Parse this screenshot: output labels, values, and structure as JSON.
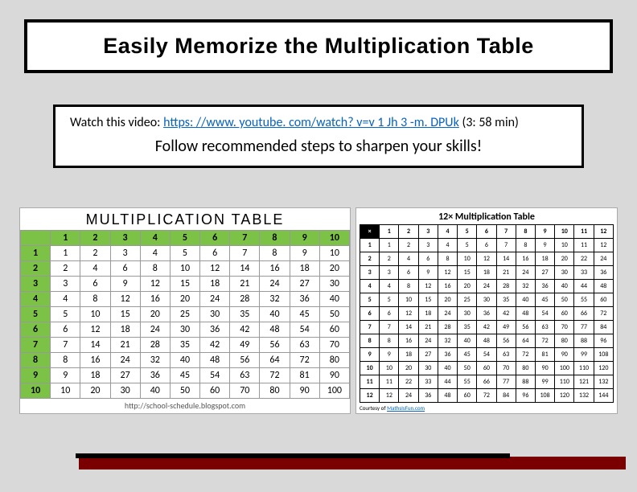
{
  "title": "Easily Memorize the Multiplication Table",
  "watch": {
    "prefix": "Watch this video: ",
    "link_text": "https: //www. youtube. com/watch? v=v 1 Jh 3 -m. DPUk",
    "duration": " (3: 58 min)"
  },
  "follow": "Follow recommended steps to sharpen your skills!",
  "table10": {
    "title": "MULTIPLICATION TABLE",
    "headers": [
      "1",
      "2",
      "3",
      "4",
      "5",
      "6",
      "7",
      "8",
      "9",
      "10"
    ],
    "rows": [
      {
        "h": "1",
        "c": [
          "1",
          "2",
          "3",
          "4",
          "5",
          "6",
          "7",
          "8",
          "9",
          "10"
        ]
      },
      {
        "h": "2",
        "c": [
          "2",
          "4",
          "6",
          "8",
          "10",
          "12",
          "14",
          "16",
          "18",
          "20"
        ]
      },
      {
        "h": "3",
        "c": [
          "3",
          "6",
          "9",
          "12",
          "15",
          "18",
          "21",
          "24",
          "27",
          "30"
        ]
      },
      {
        "h": "4",
        "c": [
          "4",
          "8",
          "12",
          "16",
          "20",
          "24",
          "28",
          "32",
          "36",
          "40"
        ]
      },
      {
        "h": "5",
        "c": [
          "5",
          "10",
          "15",
          "20",
          "25",
          "30",
          "35",
          "40",
          "45",
          "50"
        ]
      },
      {
        "h": "6",
        "c": [
          "6",
          "12",
          "18",
          "24",
          "30",
          "36",
          "42",
          "48",
          "54",
          "60"
        ]
      },
      {
        "h": "7",
        "c": [
          "7",
          "14",
          "21",
          "28",
          "35",
          "42",
          "49",
          "56",
          "63",
          "70"
        ]
      },
      {
        "h": "8",
        "c": [
          "8",
          "16",
          "24",
          "32",
          "40",
          "48",
          "56",
          "64",
          "72",
          "80"
        ]
      },
      {
        "h": "9",
        "c": [
          "9",
          "18",
          "27",
          "36",
          "45",
          "54",
          "63",
          "72",
          "81",
          "90"
        ]
      },
      {
        "h": "10",
        "c": [
          "10",
          "20",
          "30",
          "40",
          "50",
          "60",
          "70",
          "80",
          "90",
          "100"
        ]
      }
    ],
    "caption": "http://school-schedule.blogspot.com"
  },
  "table12": {
    "title": "12× Multiplication Table",
    "corner": "×",
    "headers": [
      "1",
      "2",
      "3",
      "4",
      "5",
      "6",
      "7",
      "8",
      "9",
      "10",
      "11",
      "12"
    ],
    "rows": [
      {
        "h": "1",
        "c": [
          "1",
          "2",
          "3",
          "4",
          "5",
          "6",
          "7",
          "8",
          "9",
          "10",
          "11",
          "12"
        ]
      },
      {
        "h": "2",
        "c": [
          "2",
          "4",
          "6",
          "8",
          "10",
          "12",
          "14",
          "16",
          "18",
          "20",
          "22",
          "24"
        ]
      },
      {
        "h": "3",
        "c": [
          "3",
          "6",
          "9",
          "12",
          "15",
          "18",
          "21",
          "24",
          "27",
          "30",
          "33",
          "36"
        ]
      },
      {
        "h": "4",
        "c": [
          "4",
          "8",
          "12",
          "16",
          "20",
          "24",
          "28",
          "32",
          "36",
          "40",
          "44",
          "48"
        ]
      },
      {
        "h": "5",
        "c": [
          "5",
          "10",
          "15",
          "20",
          "25",
          "30",
          "35",
          "40",
          "45",
          "50",
          "55",
          "60"
        ]
      },
      {
        "h": "6",
        "c": [
          "6",
          "12",
          "18",
          "24",
          "30",
          "36",
          "42",
          "48",
          "54",
          "60",
          "66",
          "72"
        ]
      },
      {
        "h": "7",
        "c": [
          "7",
          "14",
          "21",
          "28",
          "35",
          "42",
          "49",
          "56",
          "63",
          "70",
          "77",
          "84"
        ]
      },
      {
        "h": "8",
        "c": [
          "8",
          "16",
          "24",
          "32",
          "40",
          "48",
          "56",
          "64",
          "72",
          "80",
          "88",
          "96"
        ]
      },
      {
        "h": "9",
        "c": [
          "9",
          "18",
          "27",
          "36",
          "45",
          "54",
          "63",
          "72",
          "81",
          "90",
          "99",
          "108"
        ]
      },
      {
        "h": "10",
        "c": [
          "10",
          "20",
          "30",
          "40",
          "50",
          "60",
          "70",
          "80",
          "90",
          "100",
          "110",
          "120"
        ]
      },
      {
        "h": "11",
        "c": [
          "11",
          "22",
          "33",
          "44",
          "55",
          "66",
          "77",
          "88",
          "99",
          "110",
          "121",
          "132"
        ]
      },
      {
        "h": "12",
        "c": [
          "12",
          "24",
          "36",
          "48",
          "60",
          "72",
          "84",
          "96",
          "108",
          "120",
          "132",
          "144"
        ]
      }
    ],
    "caption_prefix": "Courtesy of ",
    "caption_link": "MathsIsFun.com"
  },
  "chart_data": [
    {
      "type": "table",
      "title": "MULTIPLICATION TABLE",
      "columns": [
        "1",
        "2",
        "3",
        "4",
        "5",
        "6",
        "7",
        "8",
        "9",
        "10"
      ],
      "row_headers": [
        "1",
        "2",
        "3",
        "4",
        "5",
        "6",
        "7",
        "8",
        "9",
        "10"
      ],
      "values": [
        [
          1,
          2,
          3,
          4,
          5,
          6,
          7,
          8,
          9,
          10
        ],
        [
          2,
          4,
          6,
          8,
          10,
          12,
          14,
          16,
          18,
          20
        ],
        [
          3,
          6,
          9,
          12,
          15,
          18,
          21,
          24,
          27,
          30
        ],
        [
          4,
          8,
          12,
          16,
          20,
          24,
          28,
          32,
          36,
          40
        ],
        [
          5,
          10,
          15,
          20,
          25,
          30,
          35,
          40,
          45,
          50
        ],
        [
          6,
          12,
          18,
          24,
          30,
          36,
          42,
          48,
          54,
          60
        ],
        [
          7,
          14,
          21,
          28,
          35,
          42,
          49,
          56,
          63,
          70
        ],
        [
          8,
          16,
          24,
          32,
          40,
          48,
          56,
          64,
          72,
          80
        ],
        [
          9,
          18,
          27,
          36,
          45,
          54,
          63,
          72,
          81,
          90
        ],
        [
          10,
          20,
          30,
          40,
          50,
          60,
          70,
          80,
          90,
          100
        ]
      ]
    },
    {
      "type": "table",
      "title": "12× Multiplication Table",
      "columns": [
        "1",
        "2",
        "3",
        "4",
        "5",
        "6",
        "7",
        "8",
        "9",
        "10",
        "11",
        "12"
      ],
      "row_headers": [
        "1",
        "2",
        "3",
        "4",
        "5",
        "6",
        "7",
        "8",
        "9",
        "10",
        "11",
        "12"
      ],
      "values": [
        [
          1,
          2,
          3,
          4,
          5,
          6,
          7,
          8,
          9,
          10,
          11,
          12
        ],
        [
          2,
          4,
          6,
          8,
          10,
          12,
          14,
          16,
          18,
          20,
          22,
          24
        ],
        [
          3,
          6,
          9,
          12,
          15,
          18,
          21,
          24,
          27,
          30,
          33,
          36
        ],
        [
          4,
          8,
          12,
          16,
          20,
          24,
          28,
          32,
          36,
          40,
          44,
          48
        ],
        [
          5,
          10,
          15,
          20,
          25,
          30,
          35,
          40,
          45,
          50,
          55,
          60
        ],
        [
          6,
          12,
          18,
          24,
          30,
          36,
          42,
          48,
          54,
          60,
          66,
          72
        ],
        [
          7,
          14,
          21,
          28,
          35,
          42,
          49,
          56,
          63,
          70,
          77,
          84
        ],
        [
          8,
          16,
          24,
          32,
          40,
          48,
          56,
          64,
          72,
          80,
          88,
          96
        ],
        [
          9,
          18,
          27,
          36,
          45,
          54,
          63,
          72,
          81,
          90,
          99,
          108
        ],
        [
          10,
          20,
          30,
          40,
          50,
          60,
          70,
          80,
          90,
          100,
          110,
          120
        ],
        [
          11,
          22,
          33,
          44,
          55,
          66,
          77,
          88,
          99,
          110,
          121,
          132
        ],
        [
          12,
          24,
          36,
          48,
          60,
          72,
          84,
          96,
          108,
          120,
          132,
          144
        ]
      ]
    }
  ]
}
